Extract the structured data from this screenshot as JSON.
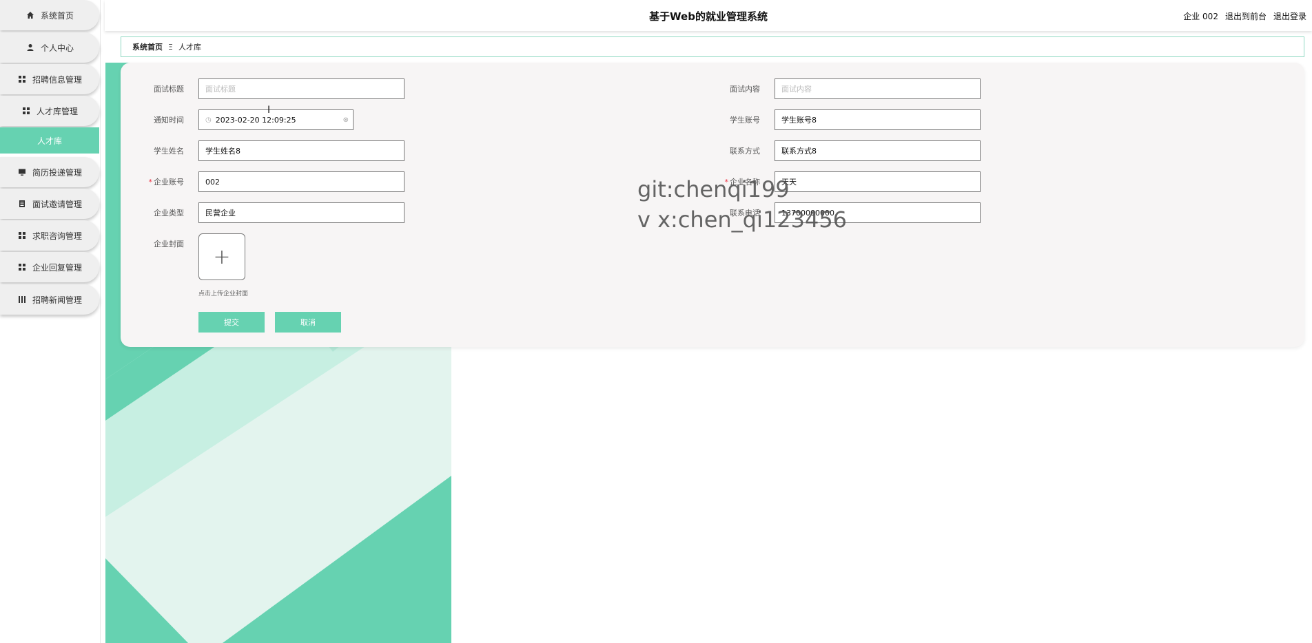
{
  "header": {
    "title": "基于Web的就业管理系统",
    "user": "企业 002",
    "to_front": "退出到前台",
    "logout": "退出登录"
  },
  "sidebar": {
    "items": [
      {
        "label": "系统首页",
        "icon": "home-icon"
      },
      {
        "label": "个人中心",
        "icon": "user-icon"
      },
      {
        "label": "招聘信息管理",
        "icon": "grid-icon"
      },
      {
        "label": "人才库管理",
        "icon": "grid-icon"
      },
      {
        "label": "简历投递管理",
        "icon": "monitor-icon"
      },
      {
        "label": "面试邀请管理",
        "icon": "document-icon"
      },
      {
        "label": "求职咨询管理",
        "icon": "grid-icon"
      },
      {
        "label": "企业回复管理",
        "icon": "grid-icon"
      },
      {
        "label": "招聘新闻管理",
        "icon": "bars-icon"
      }
    ],
    "active_sub": "人才库"
  },
  "breadcrumb": {
    "home": "系统首页",
    "separator": "Ξ",
    "current": "人才库"
  },
  "form": {
    "interview_title": {
      "label": "面试标题",
      "placeholder": "面试标题"
    },
    "interview_content": {
      "label": "面试内容",
      "placeholder": "面试内容"
    },
    "notify_time": {
      "label": "通知时间",
      "value": "2023-02-20 12:09:25"
    },
    "student_account": {
      "label": "学生账号",
      "value": "学生账号8"
    },
    "student_name": {
      "label": "学生姓名",
      "value": "学生姓名8"
    },
    "contact": {
      "label": "联系方式",
      "value": "联系方式8"
    },
    "company_account": {
      "label": "企业账号",
      "value": "002",
      "required": "*"
    },
    "company_name": {
      "label": "企业名称",
      "value": "天天",
      "required": "*"
    },
    "company_type": {
      "label": "企业类型",
      "value": "民营企业"
    },
    "phone": {
      "label": "联系电话",
      "value": "13700000000"
    },
    "cover": {
      "label": "企业封面",
      "tip": "点击上传企业封面",
      "upload_symbol": "+"
    },
    "submit_label": "提交",
    "cancel_label": "取消"
  },
  "watermark": {
    "line1": "git:chenqi199",
    "line2": "v x:chen_qi123456"
  },
  "colors": {
    "accent": "#66d2b1",
    "sidebar_bg": "#efefef",
    "card_bg": "#f7f5f5"
  }
}
